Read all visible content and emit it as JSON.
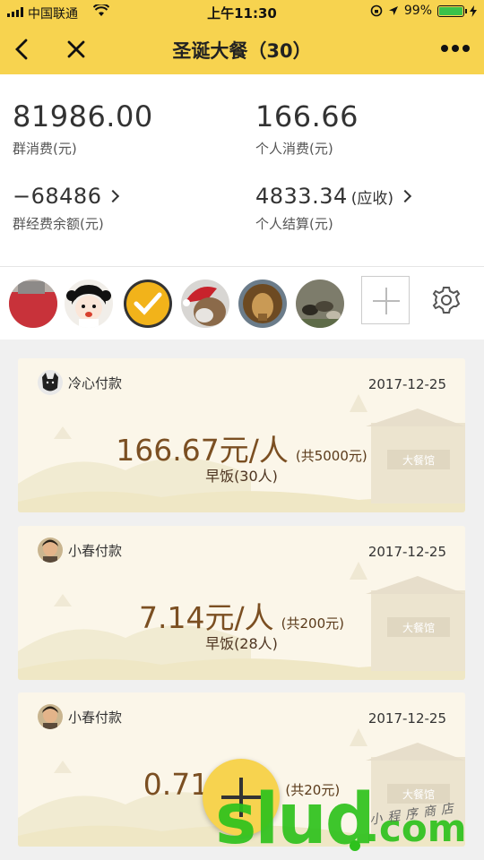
{
  "status_bar": {
    "carrier": "中国联通",
    "time": "上午11:30",
    "battery": "99%",
    "battery_level": 0.99
  },
  "nav": {
    "title": "圣诞大餐（30）"
  },
  "summary": {
    "group_spend": {
      "value": "81986.00",
      "label": "群消费(元)"
    },
    "personal_spend": {
      "value": "166.66",
      "label": "个人消费(元)"
    },
    "group_fund": {
      "value": "−68486",
      "label": "群经费余额(元)"
    },
    "personal_settle": {
      "value": "4833.34",
      "suffix": "(应收)",
      "label": "个人结算(元)"
    }
  },
  "members": [
    {
      "name": "member-avatar-1",
      "color": "#c8323a"
    },
    {
      "name": "member-avatar-2",
      "color": "#e9e4df"
    },
    {
      "name": "member-avatar-3",
      "color": "#f2b31a"
    },
    {
      "name": "member-avatar-4",
      "color": "#8b6a4a"
    },
    {
      "name": "member-avatar-5",
      "color": "#a57a3e"
    },
    {
      "name": "member-avatar-6",
      "color": "#6d6a58"
    }
  ],
  "records": [
    {
      "payer": "冷心付款",
      "date": "2017-12-25",
      "per_person": "166.67元/人",
      "total": "(共5000元)",
      "meal": "早饭(30人)"
    },
    {
      "payer": "小春付款",
      "date": "2017-12-25",
      "per_person": "7.14元/人",
      "total": "(共200元)",
      "meal": "早饭(28人)"
    },
    {
      "payer": "小春付款",
      "date": "2017-12-25",
      "per_person": "0.71元/人",
      "total": "(共20元)",
      "meal": ""
    }
  ],
  "card_sign": "大餐馆",
  "watermark": {
    "text": "slud",
    "com": ".com",
    "script": "小程序商店"
  },
  "colors": {
    "accent": "#f7d34f",
    "amount": "#7b4f22",
    "watermark": "#2ec21d"
  }
}
